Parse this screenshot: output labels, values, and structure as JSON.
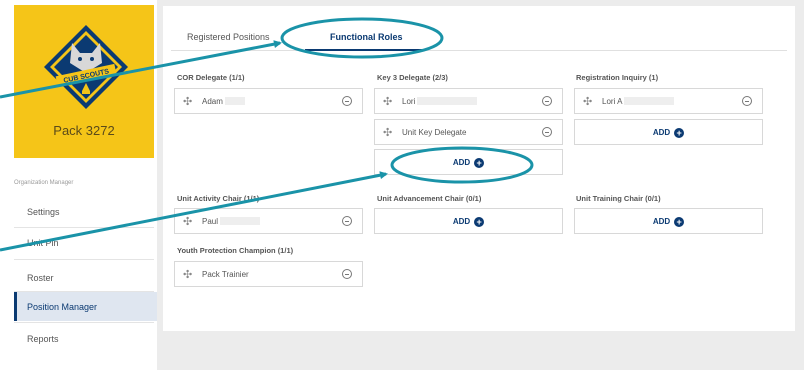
{
  "sidebar": {
    "pack_name": "Pack 3272",
    "logo_text": "CUB SCOUTS",
    "section_label": "Organization Manager",
    "items": [
      {
        "label": "Settings"
      },
      {
        "label": "Unit Pin"
      },
      {
        "label": "Roster"
      },
      {
        "label": "Position Manager"
      },
      {
        "label": "Reports"
      }
    ]
  },
  "tabs": [
    {
      "label": "Registered Positions"
    },
    {
      "label": "Functional Roles"
    }
  ],
  "groups": {
    "cor": {
      "title": "COR Delegate (1/1)",
      "members": [
        "Adam"
      ]
    },
    "key3": {
      "title": "Key 3 Delegate (2/3)",
      "members": [
        "Lori",
        "Unit Key Delegate"
      ],
      "add_label": "ADD"
    },
    "registration": {
      "title": "Registration Inquiry (1)",
      "members": [
        "Lori A"
      ],
      "add_label": "ADD"
    },
    "activity": {
      "title": "Unit Activity Chair (1/1)",
      "members": [
        "Paul"
      ]
    },
    "advancement": {
      "title": "Unit Advancement Chair (0/1)",
      "add_label": "ADD"
    },
    "training": {
      "title": "Unit Training Chair (0/1)",
      "add_label": "ADD"
    },
    "youth": {
      "title": "Youth Protection Champion (1/1)",
      "members": [
        "Pack Trainier"
      ]
    }
  },
  "colors": {
    "brand_yellow": "#f5c518",
    "accent_navy": "#0b3a72",
    "annotation_teal": "#1a93a8"
  },
  "icons": {
    "grip": "drag-handle-icon",
    "remove": "minus-circle-icon",
    "add": "plus-circle-icon"
  }
}
